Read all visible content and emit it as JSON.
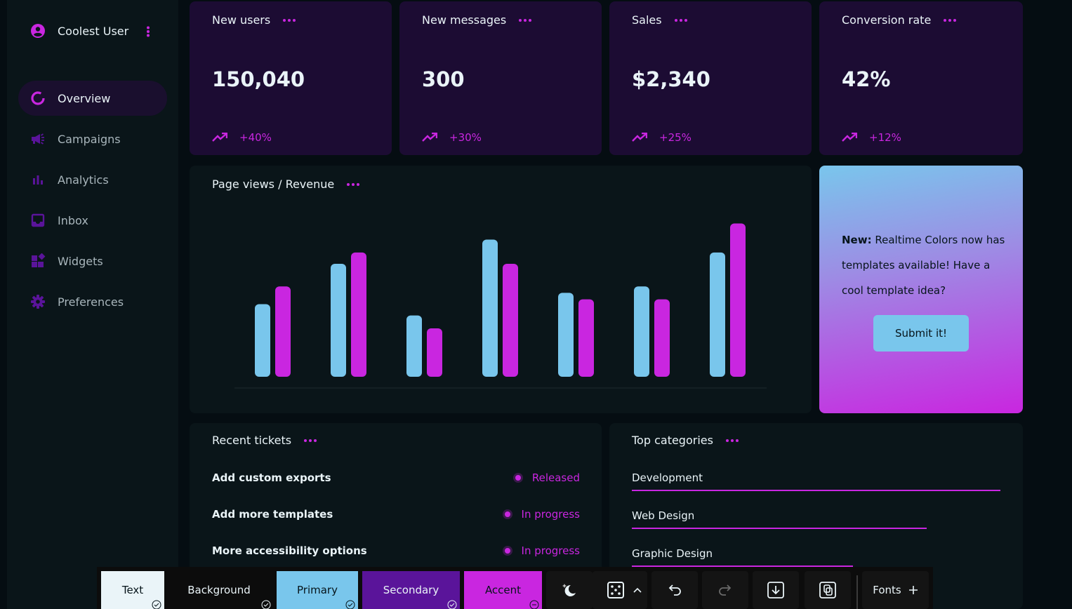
{
  "sidebar": {
    "user_name": "Coolest User",
    "items": [
      {
        "label": "Overview",
        "icon": "donut-icon",
        "active": true
      },
      {
        "label": "Campaigns",
        "icon": "megaphone-icon"
      },
      {
        "label": "Analytics",
        "icon": "bar-chart-icon"
      },
      {
        "label": "Inbox",
        "icon": "inbox-icon"
      },
      {
        "label": "Widgets",
        "icon": "widgets-icon"
      },
      {
        "label": "Preferences",
        "icon": "gear-icon"
      }
    ]
  },
  "stats": [
    {
      "title": "New users",
      "value": "150,040",
      "change": "+40%"
    },
    {
      "title": "New messages",
      "value": "300",
      "change": "+30%"
    },
    {
      "title": "Sales",
      "value": "$2,340",
      "change": "+25%"
    },
    {
      "title": "Conversion rate",
      "value": "42%",
      "change": "+12%"
    }
  ],
  "chart_title": "Page views / Revenue",
  "chart_data": {
    "type": "bar",
    "categories": [
      "",
      "",
      "",
      "",
      "",
      "",
      ""
    ],
    "series": [
      {
        "values": [
          45,
          70,
          38,
          85,
          52,
          56,
          77
        ],
        "color": "#79c6ec"
      },
      {
        "values": [
          56,
          77,
          30,
          70,
          48,
          48,
          95
        ],
        "color": "#c926e0"
      }
    ],
    "ylim": [
      0,
      100
    ],
    "grid": false
  },
  "promo": {
    "bold": "New:",
    "text": " Realtime Colors now has templates available! Have a cool template idea?",
    "button": "Submit it!"
  },
  "tickets": {
    "title": "Recent tickets",
    "rows": [
      {
        "name": "Add custom exports",
        "status": "Released"
      },
      {
        "name": "Add more templates",
        "status": "In progress"
      },
      {
        "name": "More accessibility options",
        "status": "In progress"
      }
    ]
  },
  "categories": {
    "title": "Top categories",
    "rows": [
      {
        "name": "Development",
        "share": 1.0
      },
      {
        "name": "Web Design",
        "share": 0.8
      },
      {
        "name": "Graphic Design",
        "share": 0.6
      }
    ]
  },
  "toolbar": {
    "swatches": [
      {
        "label": "Text",
        "color": "#eaf4f8"
      },
      {
        "label": "Background",
        "color": "#050d12"
      },
      {
        "label": "Primary",
        "color": "#79c6ec"
      },
      {
        "label": "Secondary",
        "color": "#5a149a"
      },
      {
        "label": "Accent",
        "color": "#c926e0"
      }
    ],
    "fonts_label": "Fonts"
  },
  "colors": {
    "accent": "#c926e0",
    "primary": "#79c6ec",
    "card": "#1c0c33",
    "background": "#050d12"
  }
}
